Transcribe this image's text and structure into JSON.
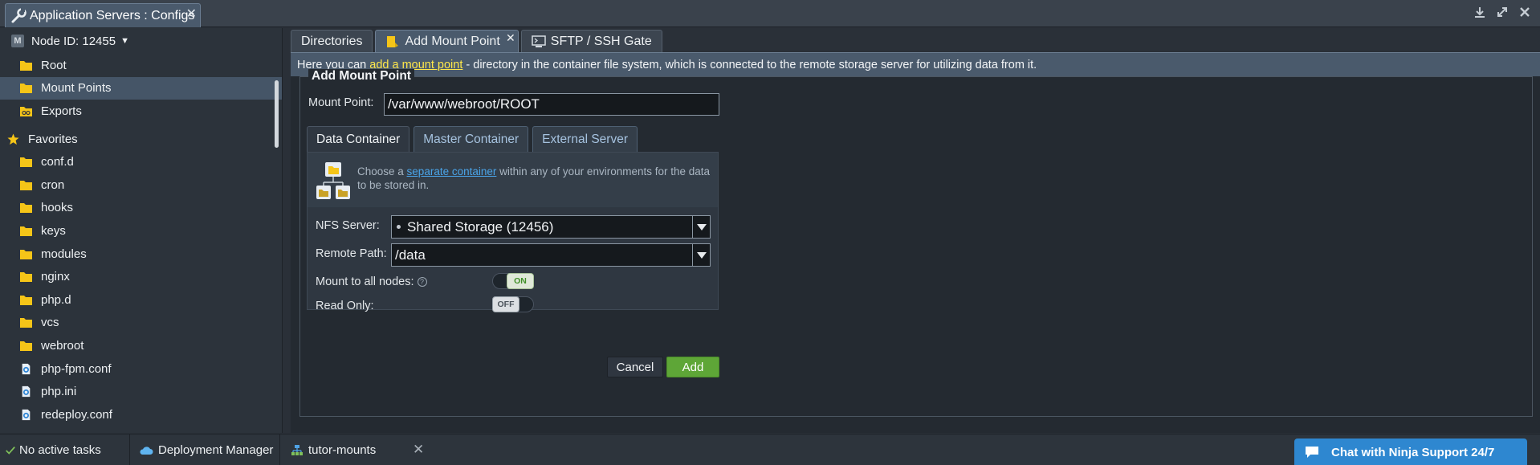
{
  "window": {
    "title": "Application Servers : Configs",
    "close": "✕"
  },
  "sidebar": {
    "node_label": "Node ID: 12455",
    "node_icon": "M",
    "items": [
      {
        "label": "Root",
        "icon": "folder-icon"
      },
      {
        "label": "Mount Points",
        "icon": "folder-icon",
        "selected": true
      },
      {
        "label": "Exports",
        "icon": "exports-folder-icon"
      }
    ],
    "favorites_label": "Favorites",
    "favorites": [
      {
        "label": "conf.d",
        "icon": "folder-icon"
      },
      {
        "label": "cron",
        "icon": "folder-icon"
      },
      {
        "label": "hooks",
        "icon": "folder-icon"
      },
      {
        "label": "keys",
        "icon": "folder-icon"
      },
      {
        "label": "modules",
        "icon": "folder-icon"
      },
      {
        "label": "nginx",
        "icon": "folder-icon"
      },
      {
        "label": "php.d",
        "icon": "folder-icon"
      },
      {
        "label": "vcs",
        "icon": "folder-icon"
      },
      {
        "label": "webroot",
        "icon": "folder-icon"
      },
      {
        "label": "php-fpm.conf",
        "icon": "file-icon"
      },
      {
        "label": "php.ini",
        "icon": "file-icon"
      },
      {
        "label": "redeploy.conf",
        "icon": "file-icon"
      }
    ]
  },
  "tabs": [
    {
      "label": "Directories"
    },
    {
      "label": "Add Mount Point",
      "active": true,
      "close": "✕"
    },
    {
      "label": "SFTP / SSH Gate"
    }
  ],
  "info": {
    "prefix": "Here you can ",
    "link": "add a mount point",
    "suffix": " - directory in the container file system, which is connected to the remote storage server for utilizing data from it."
  },
  "form": {
    "legend": "Add Mount Point",
    "mount_point_label": "Mount Point:",
    "mount_point_value": "/var/www/webroot/ROOT",
    "source_tabs": [
      {
        "label": "Data Container",
        "active": true
      },
      {
        "label": "Master Container"
      },
      {
        "label": "External Server"
      }
    ],
    "description_prefix": "Choose a ",
    "description_link": "separate container",
    "description_suffix": " within any of your environments for the data to be stored in.",
    "nfs_server_label": "NFS Server:",
    "nfs_server_value": "Shared Storage (12456)",
    "remote_path_label": "Remote Path:",
    "remote_path_value": "/data",
    "mount_all_label": "Mount to all nodes:",
    "help_glyph": "?",
    "mount_all_state": "ON",
    "read_only_label": "Read Only:",
    "read_only_state": "OFF",
    "cancel_label": "Cancel",
    "add_label": "Add"
  },
  "taskbar": {
    "tasks_label": "No active tasks",
    "deployment_label": "Deployment Manager",
    "env_label": "tutor-mounts",
    "env_close": "✕",
    "chat_label": "Chat with Ninja Support 24/7"
  },
  "colors": {
    "accent_green": "#5ea637",
    "link_yellow": "#ffe84a",
    "link_blue": "#4aa4e8",
    "chat_blue": "#2e87d0",
    "folder_yellow": "#f5c518"
  }
}
